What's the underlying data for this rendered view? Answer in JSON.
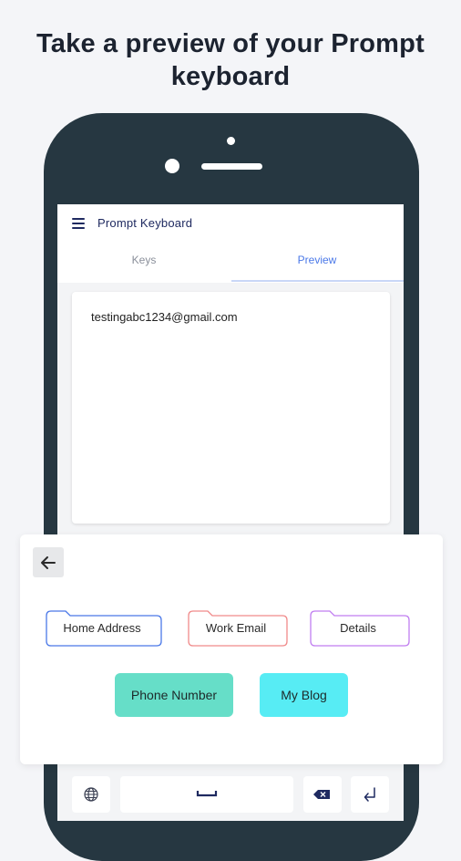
{
  "headline": {
    "line1": "Take a preview of your Prompt",
    "line2": "keyboard"
  },
  "app": {
    "title": "Prompt Keyboard",
    "tabs": [
      {
        "label": "Keys"
      },
      {
        "label": "Preview"
      }
    ],
    "active_tab": "Preview",
    "preview_text": "testingabc1234@gmail.com"
  },
  "prompts": {
    "folders": [
      {
        "label": "Home Address",
        "color": "#4a78e8"
      },
      {
        "label": "Work Email",
        "color": "#f08a8a"
      },
      {
        "label": "Details",
        "color": "#c07ef0"
      }
    ],
    "pills": [
      {
        "label": "Phone Number",
        "color": "#66dec8"
      },
      {
        "label": "My Blog",
        "color": "#57ecf4"
      }
    ]
  },
  "icons": {
    "menu": "hamburger-icon",
    "back": "arrow-left-icon",
    "globe": "globe-icon",
    "space": "space-bar-icon",
    "backspace": "backspace-icon",
    "enter": "enter-icon"
  },
  "colors": {
    "phone_body": "#263741",
    "accent": "#4a78e8",
    "title_text": "#1f2a60"
  }
}
